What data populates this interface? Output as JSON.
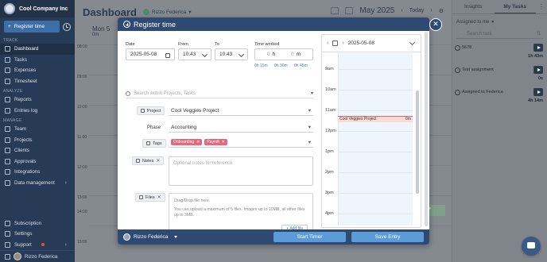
{
  "sidebar": {
    "company": "Cool Company Inc",
    "register_label": "Register time",
    "sections": {
      "track": "TRACK",
      "analyze": "ANALYZE",
      "manage": "MANAGE"
    },
    "track_items": [
      "Dashboard",
      "Tasks",
      "Expenses",
      "Timesheet"
    ],
    "analyze_items": [
      "Reports",
      "Entries log"
    ],
    "manage_items": [
      "Team",
      "Projects",
      "Clients",
      "Approvals",
      "Integrations",
      "Data management"
    ],
    "bottom_items": [
      "Subscription",
      "Settings",
      "Support"
    ],
    "user": "Rizzo Federica"
  },
  "main": {
    "title": "Dashboard",
    "user": "Rizzo Federica",
    "month": "May 2025",
    "today": "Today",
    "day_name": "Mon 5",
    "day_hours": "0m",
    "time_labels": [
      "08:00",
      "09:00",
      "10:00",
      "11:00",
      "12:00",
      "13:00",
      "14:00",
      "15:00"
    ],
    "side_event": "Fe"
  },
  "right_panel": {
    "tabs": [
      "Insights",
      "My Tasks"
    ],
    "assigned": "Assigned to me",
    "search_placeholder": "Search task",
    "tasks": [
      {
        "name": "5678",
        "time": "1h 43m"
      },
      {
        "name": "Test assignment",
        "time": "0s"
      },
      {
        "name": "Assigned to Federica",
        "time": "4h 14m"
      }
    ]
  },
  "modal": {
    "title": "Register time",
    "date_label": "Date",
    "date_value": "2025-05-08",
    "from_label": "From",
    "from_value": "10:43",
    "to_label": "To",
    "to_value": "10:43",
    "time_worked_label": "Time worked",
    "hours_value": "0",
    "hours_unit": "h",
    "minutes_value": "0",
    "minutes_unit": "m",
    "quick_options": [
      "0h 15m",
      "0h 30m",
      "0h 45m"
    ],
    "search_placeholder": "Search within Projects, Tasks",
    "project_label": "Project",
    "project_value": "Cool Veggies Project",
    "phase_label": "Phase",
    "phase_value": "Accounting",
    "tags_label": "Tags",
    "tags": [
      "Onboarding",
      "Payroll"
    ],
    "notes_label": "Notes",
    "notes_placeholder": "Optional notes for reference",
    "files_label": "Files",
    "files_drop": "Drag/Drop file here.",
    "files_hint": "You can upload a maximum of 5 files. Images up to 10MB, all other files up to 3MB.",
    "add_file": "+ Add file",
    "calendar_date": "2025-05-08",
    "calendar_hours": [
      "9am",
      "10am",
      "11am",
      "12pm",
      "1pm",
      "2pm",
      "3pm",
      "4pm"
    ],
    "calendar_event": "Cool Veggies Project",
    "calendar_event_duration": "0m",
    "footer_user": "Rizzo Federica",
    "start_timer": "Start Timer",
    "save_entry": "Save Entry"
  }
}
